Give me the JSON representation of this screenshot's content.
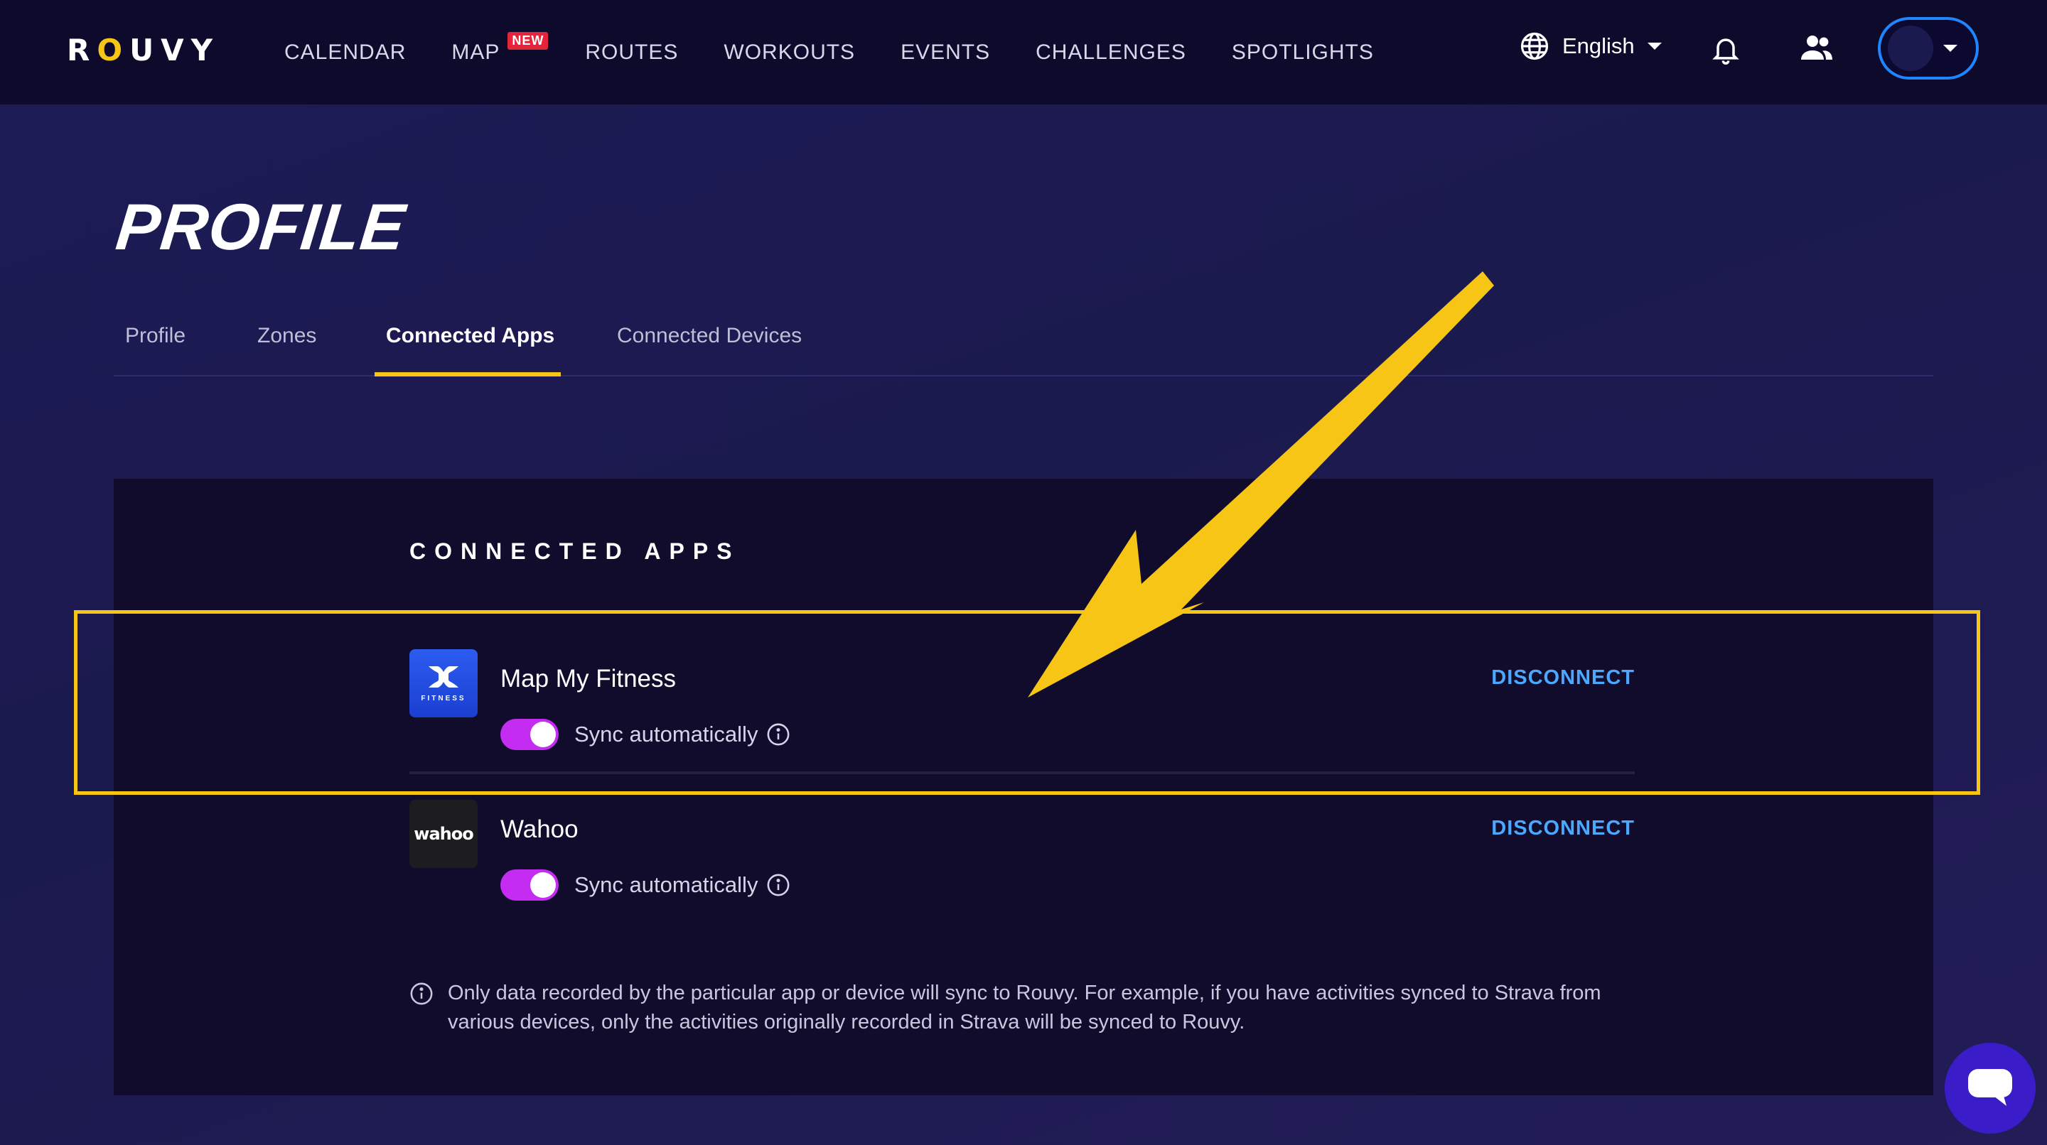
{
  "brand": {
    "logo_text_left": "R",
    "logo_text_accent": "O",
    "logo_text_right": "UVY"
  },
  "nav": {
    "items": [
      {
        "label": "CALENDAR"
      },
      {
        "label": "MAP",
        "badge": "NEW"
      },
      {
        "label": "ROUTES"
      },
      {
        "label": "WORKOUTS"
      },
      {
        "label": "EVENTS"
      },
      {
        "label": "CHALLENGES"
      },
      {
        "label": "SPOTLIGHTS"
      }
    ],
    "language": "English"
  },
  "page": {
    "title": "PROFILE",
    "tabs": [
      {
        "label": "Profile"
      },
      {
        "label": "Zones"
      },
      {
        "label": "Connected Apps",
        "active": true
      },
      {
        "label": "Connected Devices"
      }
    ]
  },
  "card": {
    "heading": "CONNECTED APPS",
    "apps": [
      {
        "name": "Map My Fitness",
        "logo_mark": "UA",
        "logo_sub": "FITNESS",
        "action": "DISCONNECT",
        "sync_label": "Sync automatically",
        "sync_on": true
      },
      {
        "name": "Wahoo",
        "logo_text": "wahoo",
        "action": "DISCONNECT",
        "sync_label": "Sync automatically",
        "sync_on": true
      }
    ],
    "footnote": "Only data recorded by the particular app or device will sync to Rouvy. For example, if you have activities synced to Strava from various devices, only the activities originally recorded in Strava will be synced to Rouvy."
  },
  "colors": {
    "accent_yellow": "#f7c515",
    "link_blue": "#4aa8ff",
    "toggle_on": "#c42cf2",
    "nav_bg": "#0d0a2b",
    "card_bg": "#110b2c"
  },
  "icons": [
    "globe-icon",
    "bell-icon",
    "people-icon",
    "info-icon",
    "chat-icon",
    "arrow-annotation"
  ]
}
